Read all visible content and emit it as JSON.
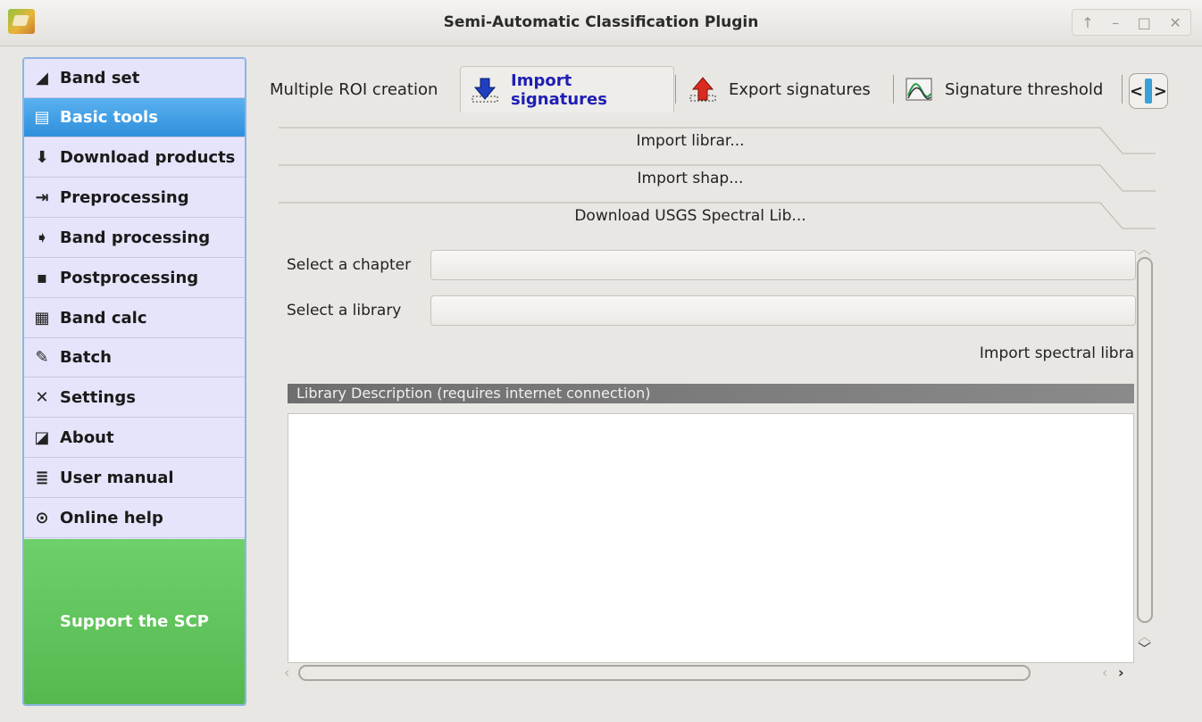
{
  "window": {
    "title": "Semi-Automatic Classification Plugin",
    "controls": [
      "↑",
      "–",
      "□",
      "✕"
    ]
  },
  "sidebar": {
    "items": [
      {
        "label": "Band set",
        "icon": "layers-icon",
        "glyph": "◢"
      },
      {
        "label": "Basic tools",
        "icon": "tools-icon",
        "glyph": "▤",
        "active": true
      },
      {
        "label": "Download products",
        "icon": "download-icon",
        "glyph": "⬇"
      },
      {
        "label": "Preprocessing",
        "icon": "preprocessing-icon",
        "glyph": "⇥"
      },
      {
        "label": "Band processing",
        "icon": "band-processing-icon",
        "glyph": "➧"
      },
      {
        "label": "Postprocessing",
        "icon": "postprocessing-icon",
        "glyph": "▪"
      },
      {
        "label": "Band calc",
        "icon": "calculator-icon",
        "glyph": "▦"
      },
      {
        "label": "Batch",
        "icon": "batch-icon",
        "glyph": "✎"
      },
      {
        "label": "Settings",
        "icon": "settings-icon",
        "glyph": "✕"
      },
      {
        "label": "About",
        "icon": "about-icon",
        "glyph": "◪"
      },
      {
        "label": "User manual",
        "icon": "manual-icon",
        "glyph": "≣"
      },
      {
        "label": "Online help",
        "icon": "help-icon",
        "glyph": "⊙"
      }
    ],
    "support_label": "Support the SCP",
    "colors": {
      "active": "#3b98e0",
      "support": "#5fc45a",
      "item_bg": "#e5e4fa"
    }
  },
  "tabs": [
    {
      "label": "Multiple ROI creation"
    },
    {
      "label": "Import signatures",
      "icon": "import-arrow-icon",
      "active": true
    },
    {
      "label": "Export signatures",
      "icon": "export-arrow-icon"
    },
    {
      "label": "Signature threshold",
      "icon": "threshold-chart-icon"
    }
  ],
  "tab_scroll": {
    "left": "<",
    "right": ">"
  },
  "accordion": [
    {
      "label": "Import librar..."
    },
    {
      "label": "Import shap..."
    },
    {
      "label": "Download USGS Spectral Lib..."
    }
  ],
  "form": {
    "chapter_label": "Select a chapter",
    "chapter_value": "",
    "library_label": "Select a library",
    "library_value": "",
    "import_button": "Import spectral libra",
    "description_header": "Library Description (requires internet connection)"
  }
}
